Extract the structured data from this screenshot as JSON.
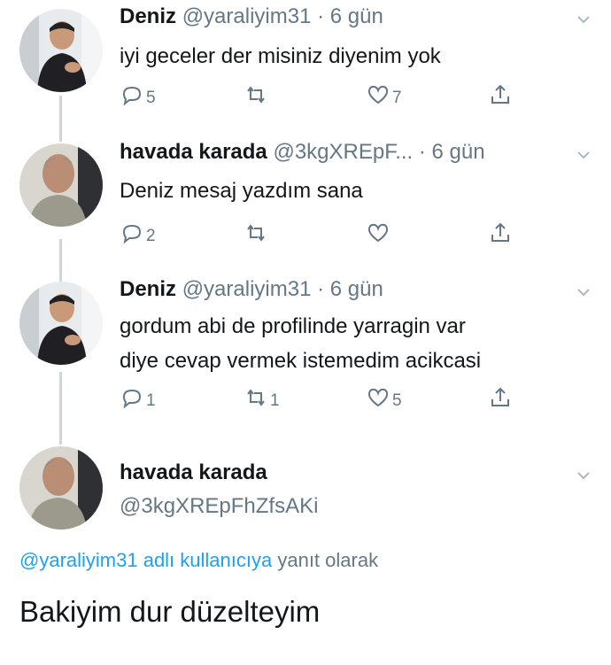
{
  "tweets": [
    {
      "name": "Deniz",
      "meta": "@yaraliyim31 · 6 gün",
      "lines": [
        "iyi geceler der misiniz diyenim yok"
      ],
      "reply_count": "5",
      "retweet_count": "",
      "like_count": "7"
    },
    {
      "name": "havada karada",
      "meta": "@3kgXREpF... · 6 gün",
      "lines": [
        "Deniz mesaj yazdım sana"
      ],
      "reply_count": "2",
      "retweet_count": "",
      "like_count": ""
    },
    {
      "name": "Deniz",
      "meta": "@yaraliyim31 · 6 gün",
      "lines": [
        "gordum abi de profilinde yarragin var",
        "diye cevap vermek istemedim acikcasi"
      ],
      "reply_count": "1",
      "retweet_count": "1",
      "like_count": "5"
    }
  ],
  "focused": {
    "name": "havada karada",
    "handle": "@3kgXREpFhZfsAKi",
    "reply_handle": "@yaraliyim31 adlı kullanıcıya",
    "reply_suffix": " yanıt olarak",
    "text": "Bakiyim dur düzelteyim"
  },
  "colors": {
    "accent": "#1da1f2",
    "muted": "#657786",
    "thread_line": "#ccd6dd"
  },
  "icons": [
    "reply-icon",
    "retweet-icon",
    "like-icon",
    "share-icon",
    "chevron-down-icon"
  ]
}
